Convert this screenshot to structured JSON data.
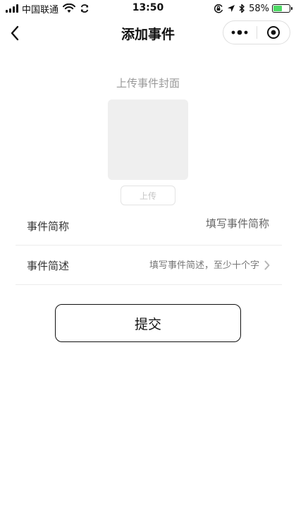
{
  "status_bar": {
    "carrier": "中国联通",
    "time": "13:50",
    "battery_percent_label": "58%",
    "battery_level": 0.58,
    "icons": [
      "signal-icon",
      "wifi-icon",
      "sync-icon",
      "orientation-lock-icon",
      "location-arrow-icon",
      "bluetooth-icon",
      "battery-icon"
    ]
  },
  "nav": {
    "title": "添加事件",
    "icons": [
      "back-chevron-icon",
      "more-dots-icon",
      "target-circle-icon"
    ]
  },
  "cover": {
    "title": "上传事件封面",
    "upload_label": "上传"
  },
  "form": {
    "name": {
      "label": "事件简称",
      "value": "",
      "placeholder": "填写事件简称"
    },
    "desc": {
      "label": "事件简述",
      "placeholder_text": "填写事件简述，至少十个字"
    }
  },
  "submit_label": "提交",
  "colors": {
    "battery_green": "#4cd964",
    "cover_gray": "#efefef",
    "muted_text": "#999999"
  }
}
